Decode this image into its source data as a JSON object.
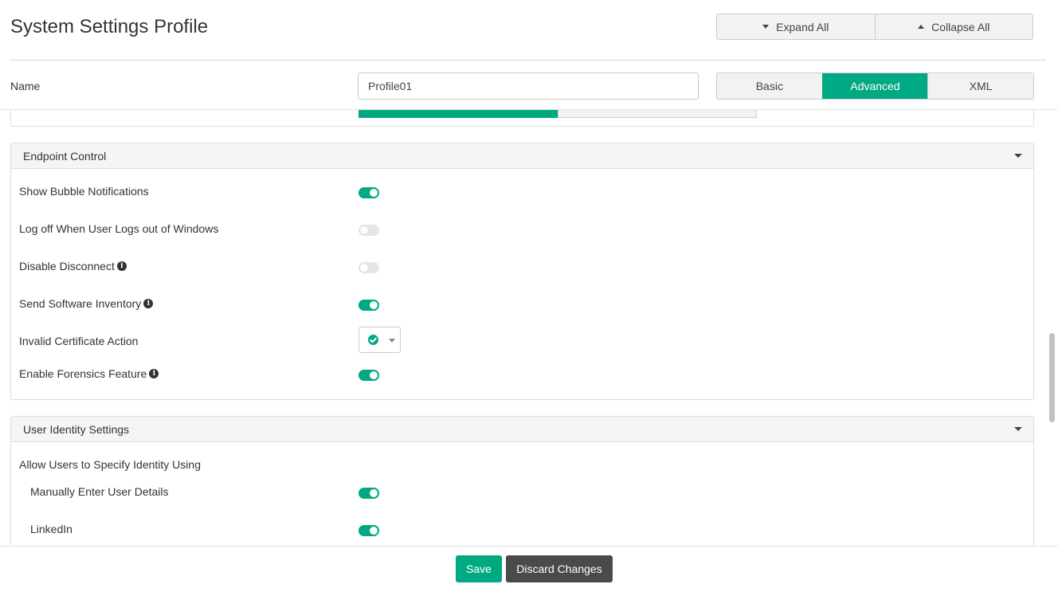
{
  "header": {
    "title": "System Settings Profile",
    "expand_all": "Expand All",
    "collapse_all": "Collapse All"
  },
  "name_row": {
    "label": "Name",
    "value": "Profile01",
    "modes": [
      {
        "label": "Basic",
        "active": false
      },
      {
        "label": "Advanced",
        "active": true
      },
      {
        "label": "XML",
        "active": false
      }
    ]
  },
  "endpoint_control": {
    "title": "Endpoint Control",
    "rows": [
      {
        "label": "Show Bubble Notifications",
        "info": false,
        "enabled": true
      },
      {
        "label": "Log off When User Logs out of Windows",
        "info": false,
        "enabled": false
      },
      {
        "label": "Disable Disconnect",
        "info": true,
        "enabled": false
      },
      {
        "label": "Send Software Inventory",
        "info": true,
        "enabled": true
      },
      {
        "label": "Invalid Certificate Action",
        "info": false,
        "control": "dropdown",
        "selected_icon": "check-circle-icon"
      },
      {
        "label": "Enable Forensics Feature",
        "info": true,
        "enabled": true
      }
    ]
  },
  "user_identity": {
    "title": "User Identity Settings",
    "intro": "Allow Users to Specify Identity Using",
    "rows": [
      {
        "label": "Manually Enter User Details",
        "enabled": true
      },
      {
        "label": "LinkedIn",
        "enabled": true
      }
    ]
  },
  "footer": {
    "save": "Save",
    "discard": "Discard Changes"
  },
  "colors": {
    "accent": "#01a982",
    "discard": "#4a4a4a"
  }
}
